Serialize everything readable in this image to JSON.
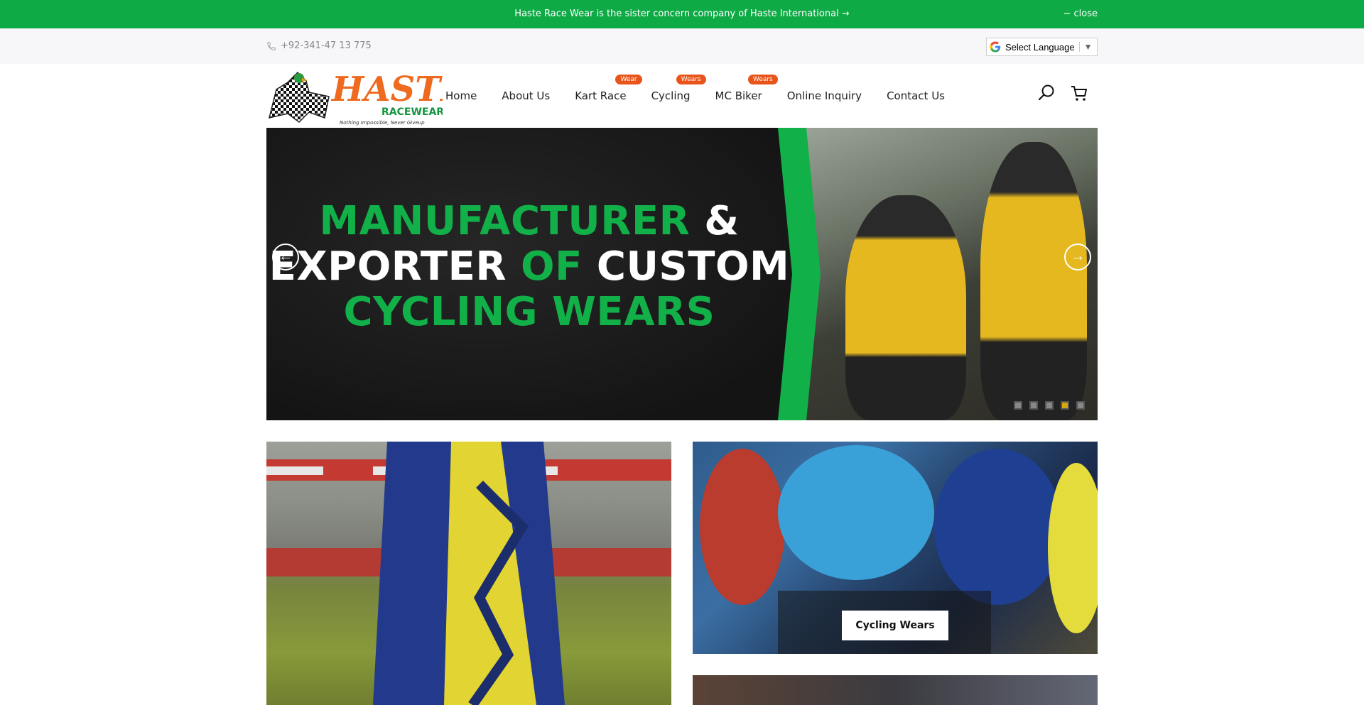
{
  "announcement": {
    "message": "Haste Race Wear is the sister concern company of Haste International →",
    "close_label": "− close"
  },
  "topbar": {
    "phone": "+92-341-47 13 775",
    "language_label": "Select Language",
    "language_arrow": "▼"
  },
  "header": {
    "logo": {
      "brand": "HASTE",
      "sub": "RACEWEAR",
      "tagline": "Nothing Impossible, Never Giveup"
    },
    "nav": [
      {
        "label": "Home",
        "badge": ""
      },
      {
        "label": "About Us",
        "badge": ""
      },
      {
        "label": "Kart Race",
        "badge": "Wear"
      },
      {
        "label": "Cycling",
        "badge": "Wears"
      },
      {
        "label": "MC Biker",
        "badge": "Wears"
      },
      {
        "label": "Online Inquiry",
        "badge": ""
      },
      {
        "label": "Contact Us",
        "badge": ""
      }
    ]
  },
  "hero": {
    "line1_green": "MANUFACTURER",
    "line1_white": "&",
    "line2_white_a": "EXPORTER",
    "line2_green": "OF",
    "line2_white_b": "CUSTOM",
    "line3_green": "CYCLING WEARS",
    "prev_arrow": "←",
    "next_arrow": "→",
    "slide_count": 5,
    "active_slide": 4
  },
  "tiles": {
    "cycling_label": "Cycling Wears"
  },
  "colors": {
    "brand_green": "#0eaa45",
    "badge_orange": "#e8541a",
    "logo_orange": "#ee6a1f"
  }
}
